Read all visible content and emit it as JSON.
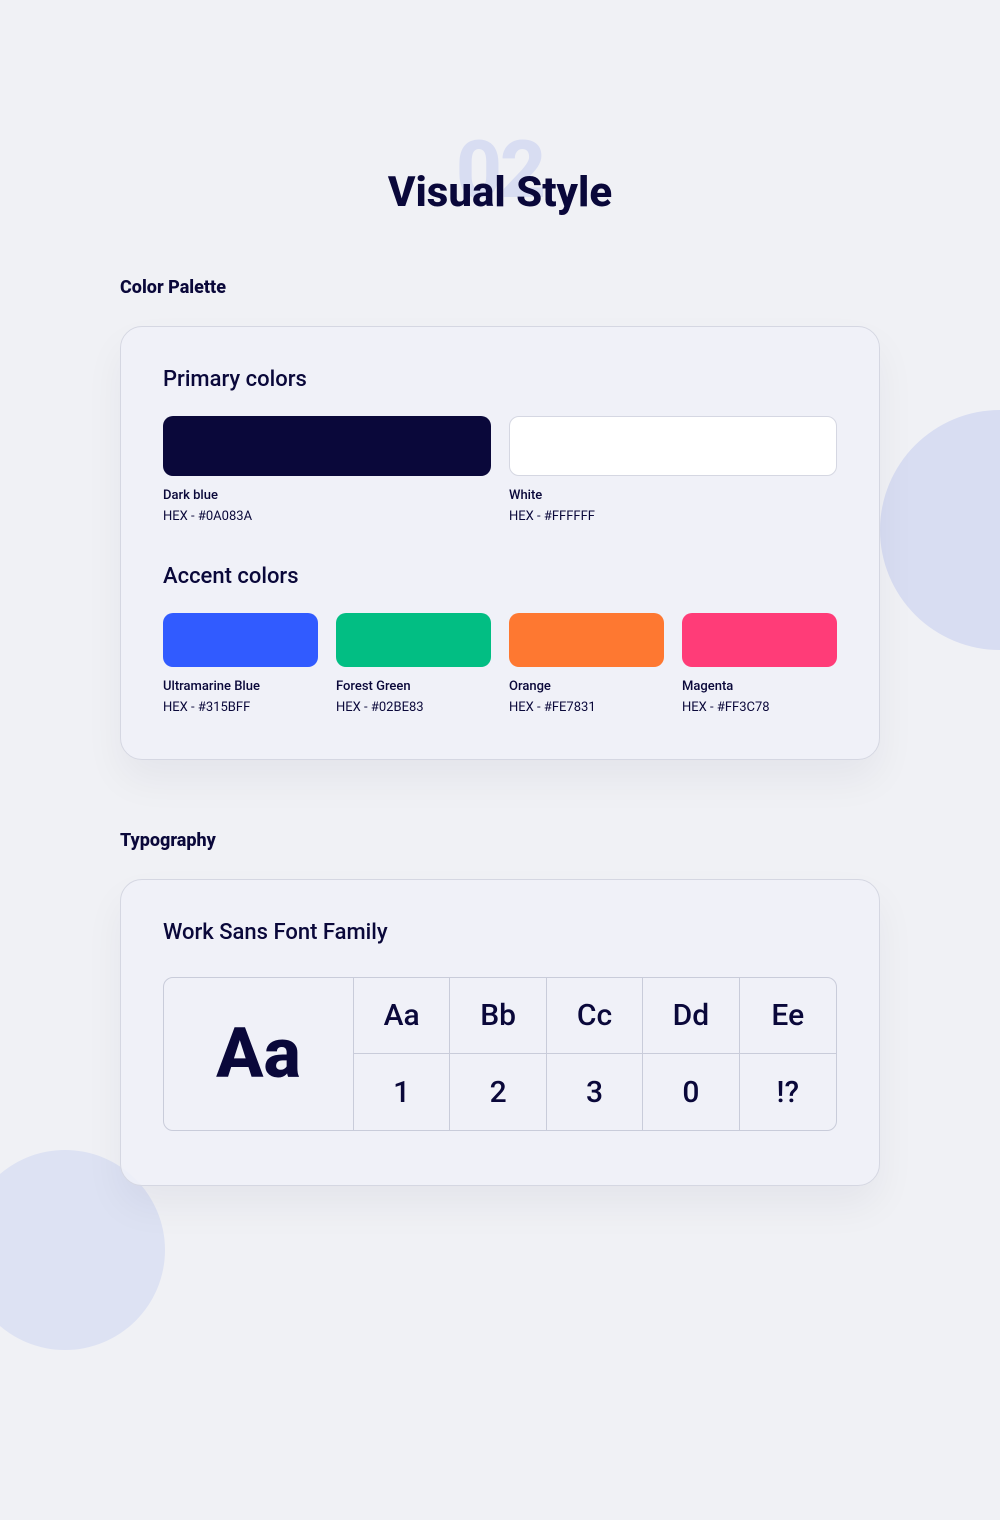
{
  "header": {
    "number": "02",
    "title": "Visual Style"
  },
  "palette": {
    "label": "Color Palette",
    "primary": {
      "title": "Primary colors",
      "colors": [
        {
          "name": "Dark blue",
          "hex_label": "HEX - #0A083A",
          "hex": "#0A083A"
        },
        {
          "name": "White",
          "hex_label": "HEX - #FFFFFF",
          "hex": "#FFFFFF"
        }
      ]
    },
    "accent": {
      "title": "Accent colors",
      "colors": [
        {
          "name": "Ultramarine Blue",
          "hex_label": "HEX - #315BFF",
          "hex": "#315BFF"
        },
        {
          "name": "Forest Green",
          "hex_label": "HEX - #02BE83",
          "hex": "#02BE83"
        },
        {
          "name": "Orange",
          "hex_label": "HEX - #FE7831",
          "hex": "#FE7831"
        },
        {
          "name": "Magenta",
          "hex_label": "HEX - #FF3C78",
          "hex": "#FF3C78"
        }
      ]
    }
  },
  "typography": {
    "label": "Typography",
    "family": "Work Sans Font Family",
    "big_sample": "Aa",
    "row1": [
      "Aa",
      "Bb",
      "Cc",
      "Dd",
      "Ee"
    ],
    "row2": [
      "1",
      "2",
      "3",
      "0",
      "!?"
    ]
  }
}
